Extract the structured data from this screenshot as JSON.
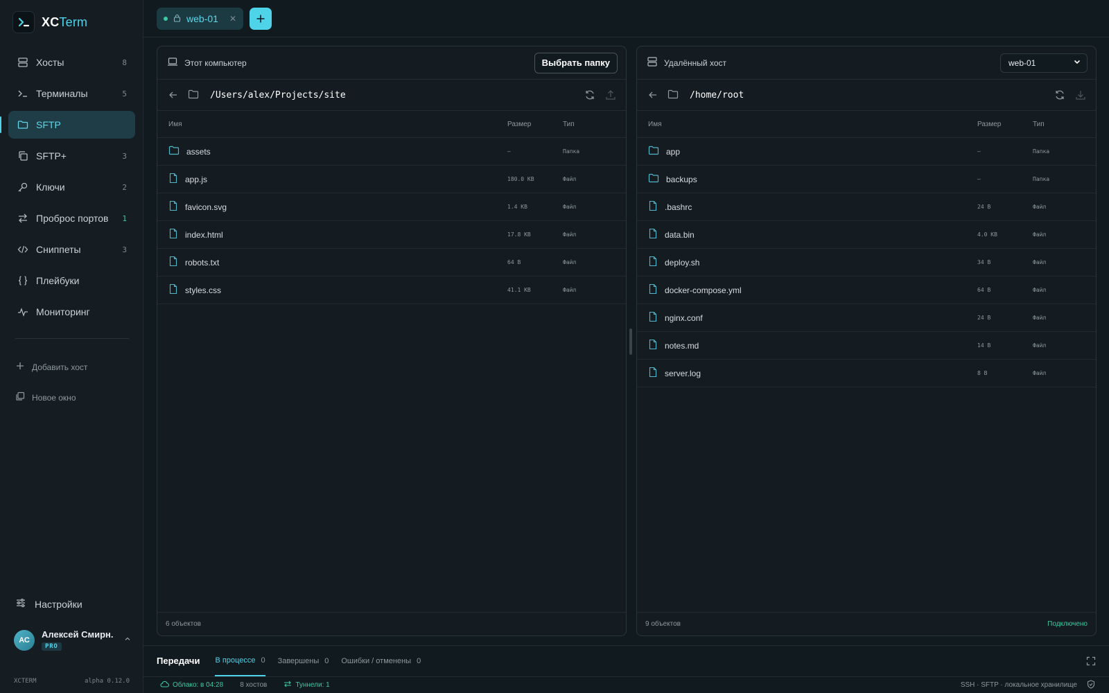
{
  "brand": {
    "name_main": "XC",
    "name_accent": "Term"
  },
  "sidebar": {
    "items": [
      {
        "label": "Хосты",
        "count": "8",
        "icon": "server-icon"
      },
      {
        "label": "Терминалы",
        "count": "5",
        "icon": "terminal-icon"
      },
      {
        "label": "SFTP",
        "count": "",
        "icon": "folder-icon"
      },
      {
        "label": "SFTP+",
        "count": "3",
        "icon": "copy-icon"
      },
      {
        "label": "Ключи",
        "count": "2",
        "icon": "key-icon"
      },
      {
        "label": "Проброс портов",
        "count": "1",
        "icon": "arrows-icon"
      },
      {
        "label": "Сниппеты",
        "count": "3",
        "icon": "code-icon"
      },
      {
        "label": "Плейбуки",
        "count": "",
        "icon": "braces-icon"
      },
      {
        "label": "Мониторинг",
        "count": "",
        "icon": "activity-icon"
      }
    ],
    "active_item": "SFTP",
    "add_host": "Добавить хост",
    "new_window": "Новое окно",
    "settings": "Настройки",
    "user": {
      "initials": "АС",
      "name": "Алексей Смирн...",
      "plan": "PRO"
    },
    "footer_left": "XCTERM",
    "footer_right": "alpha 0.12.0"
  },
  "tabs": [
    {
      "label": "web-01",
      "status_color": "#3ec9a0"
    }
  ],
  "local": {
    "title": "Этот компьютер",
    "choose_folder": "Выбрать папку",
    "path": "/Users/alex/Projects/site",
    "columns": {
      "name": "Имя",
      "size": "Размер",
      "type": "Тип"
    },
    "files": [
      {
        "name": "assets",
        "size": "—",
        "type": "Папка",
        "kind": "folder"
      },
      {
        "name": "app.js",
        "size": "180.0 KB",
        "type": "Файл",
        "kind": "file"
      },
      {
        "name": "favicon.svg",
        "size": "1.4 KB",
        "type": "Файл",
        "kind": "file"
      },
      {
        "name": "index.html",
        "size": "17.8 KB",
        "type": "Файл",
        "kind": "file"
      },
      {
        "name": "robots.txt",
        "size": "64 B",
        "type": "Файл",
        "kind": "file"
      },
      {
        "name": "styles.css",
        "size": "41.1 KB",
        "type": "Файл",
        "kind": "file"
      }
    ],
    "footer_count": "6 объектов"
  },
  "remote": {
    "title": "Удалённый хост",
    "host_select": "web-01",
    "path": "/home/root",
    "columns": {
      "name": "Имя",
      "size": "Размер",
      "type": "Тип"
    },
    "files": [
      {
        "name": "app",
        "size": "—",
        "type": "Папка",
        "kind": "folder"
      },
      {
        "name": "backups",
        "size": "—",
        "type": "Папка",
        "kind": "folder"
      },
      {
        "name": ".bashrc",
        "size": "24 B",
        "type": "Файл",
        "kind": "file"
      },
      {
        "name": "data.bin",
        "size": "4.0 KB",
        "type": "Файл",
        "kind": "file"
      },
      {
        "name": "deploy.sh",
        "size": "34 B",
        "type": "Файл",
        "kind": "file"
      },
      {
        "name": "docker-compose.yml",
        "size": "64 B",
        "type": "Файл",
        "kind": "file"
      },
      {
        "name": "nginx.conf",
        "size": "24 B",
        "type": "Файл",
        "kind": "file"
      },
      {
        "name": "notes.md",
        "size": "14 B",
        "type": "Файл",
        "kind": "file"
      },
      {
        "name": "server.log",
        "size": "8 B",
        "type": "Файл",
        "kind": "file"
      }
    ],
    "footer_count": "9 объектов",
    "status": "Подключено"
  },
  "transfers": {
    "title": "Передачи",
    "tabs": [
      {
        "label": "В процессе",
        "count": "0"
      },
      {
        "label": "Завершены",
        "count": "0"
      },
      {
        "label": "Ошибки / отменены",
        "count": "0"
      }
    ]
  },
  "statusbar": {
    "cloud": "Облако: в 04:28",
    "hosts": "8 хостов",
    "tunnels": "Туннели: 1",
    "right": "SSH · SFTP · локальное хранилище"
  },
  "colors": {
    "accent": "#4fd3e8",
    "success": "#3ec9a0",
    "background": "#111a1f"
  }
}
